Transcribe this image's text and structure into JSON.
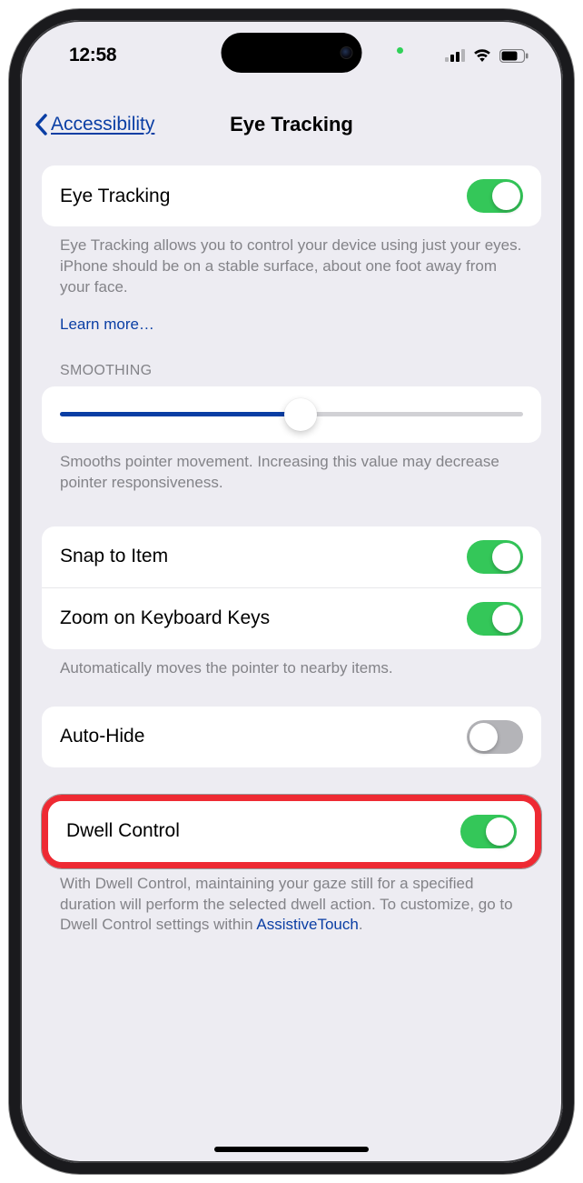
{
  "status": {
    "time": "12:58"
  },
  "nav": {
    "back_label": "Accessibility",
    "title": "Eye Tracking"
  },
  "section1": {
    "row_label": "Eye Tracking",
    "footer": "Eye Tracking allows you to control your device using just your eyes. iPhone should be on a stable surface, about one foot away from your face.",
    "learn_more": "Learn more…"
  },
  "smoothing": {
    "header": "SMOOTHING",
    "footer": "Smooths pointer movement. Increasing this value may decrease pointer responsiveness."
  },
  "snap": {
    "row1_label": "Snap to Item",
    "row2_label": "Zoom on Keyboard Keys",
    "footer": "Automatically moves the pointer to nearby items."
  },
  "autohide": {
    "row_label": "Auto-Hide"
  },
  "dwell": {
    "row_label": "Dwell Control",
    "footer_part1": "With Dwell Control, maintaining your gaze still for a specified duration will perform the selected dwell action. To customize, go to Dwell Control settings within ",
    "footer_link": "AssistiveTouch",
    "footer_part2": "."
  },
  "toggles": {
    "eye_tracking": true,
    "snap_to_item": true,
    "zoom_keys": true,
    "auto_hide": false,
    "dwell_control": true
  },
  "slider": {
    "value_pct": 52
  }
}
